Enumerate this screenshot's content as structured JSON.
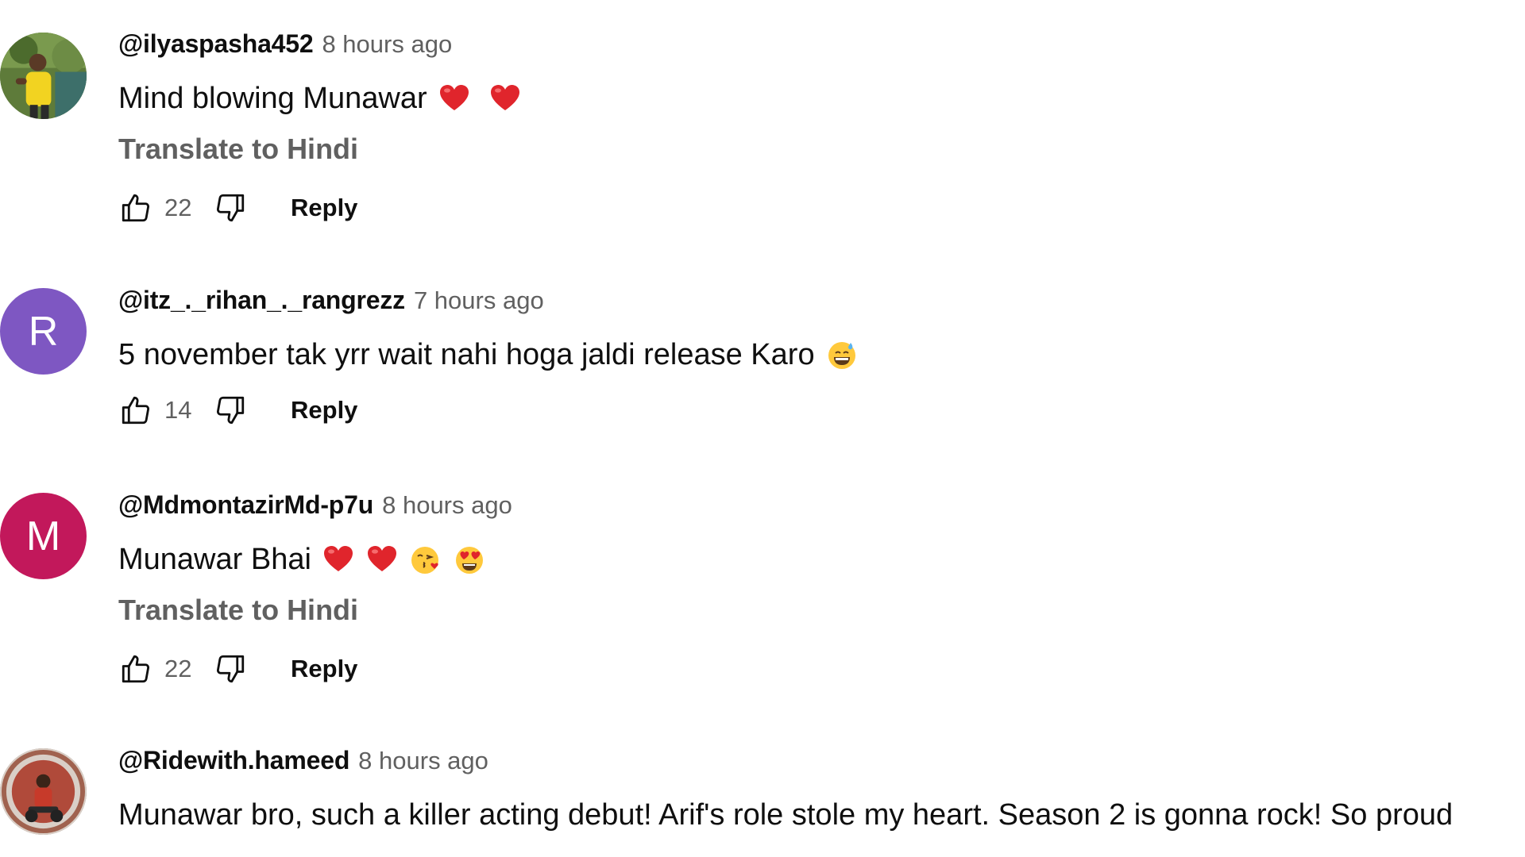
{
  "comments": [
    {
      "author": "@ilyaspasha452",
      "time": "8 hours ago",
      "text": "Mind blowing Munawar",
      "translate_label": "Translate to Hindi",
      "likes": "22",
      "reply_label": "Reply",
      "avatar_letter": "",
      "avatar_color": "#5f7a3a",
      "emojis": [
        "red-heart-emoji",
        "red-heart-emoji"
      ]
    },
    {
      "author": "@itz_._rihan_._rangrezz",
      "time": "7 hours ago",
      "text": "5 november tak yrr wait nahi hoga jaldi release Karo",
      "likes": "14",
      "reply_label": "Reply",
      "avatar_letter": "R",
      "avatar_color": "#7e57c2",
      "emojis": [
        "grinning-sweat-emoji"
      ]
    },
    {
      "author": "@MdmontazirMd-p7u",
      "time": "8 hours ago",
      "text": "Munawar Bhai",
      "translate_label": "Translate to Hindi",
      "likes": "22",
      "reply_label": "Reply",
      "avatar_letter": "M",
      "avatar_color": "#c2185b",
      "emojis": [
        "red-heart-emoji",
        "red-heart-emoji",
        "kissing-heart-emoji",
        "heart-eyes-emoji"
      ]
    },
    {
      "author": "@Ridewith.hameed",
      "time": "8 hours ago",
      "text": "Munawar bro, such a killer acting debut! Arif's role stole my heart. Season 2 is gonna rock! So proud",
      "avatar_letter": "",
      "avatar_color": "#8b6a5a"
    }
  ],
  "colors": {
    "text_primary": "#0f0f0f",
    "text_secondary": "#606060",
    "background": "#ffffff"
  }
}
